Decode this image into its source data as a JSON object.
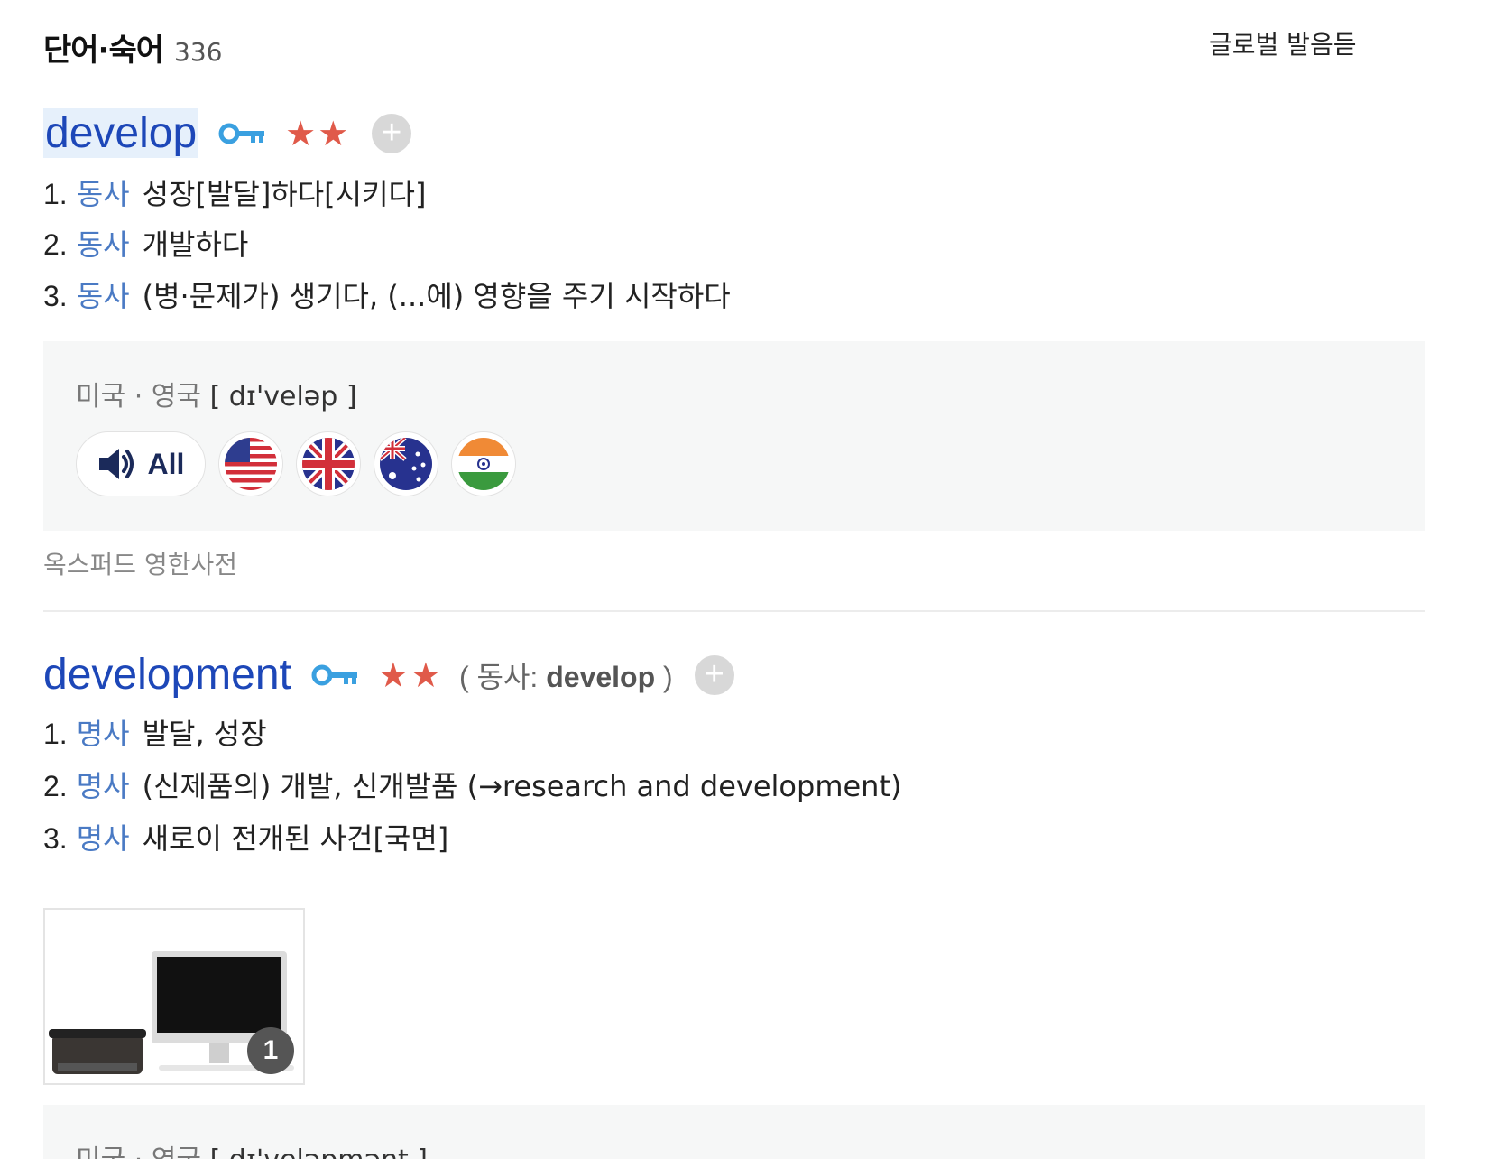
{
  "section": {
    "title": "단어·숙어",
    "count": "336",
    "global_link": "글로벌 발음듣"
  },
  "entries": [
    {
      "headword": "develop",
      "stars": "★★",
      "meanings": [
        {
          "num": "1.",
          "pos": "동사",
          "text": "성장[발달]하다[시키다]"
        },
        {
          "num": "2.",
          "pos": "동사",
          "text": "개발하다"
        },
        {
          "num": "3.",
          "pos": "동사",
          "text": "(병·문제가) 생기다, (...에) 영향을 주기 시작하다"
        }
      ],
      "pronunciation": {
        "lang": "미국 · 영국",
        "ipa": "[ dɪ'veləp ]"
      },
      "audio": {
        "all_label": "All"
      },
      "source": "옥스퍼드 영한사전"
    },
    {
      "headword": "development",
      "stars": "★★",
      "relation": {
        "prefix": "( 동사: ",
        "word": "develop",
        "suffix": " )"
      },
      "meanings": [
        {
          "num": "1.",
          "pos": "명사",
          "text": "발달, 성장"
        },
        {
          "num": "2.",
          "pos": "명사",
          "text": "(신제품의) 개발, 신개발품 (→research and development)"
        },
        {
          "num": "3.",
          "pos": "명사",
          "text": "새로이 전개된 사건[국면]"
        }
      ],
      "image_count": "1",
      "pronunciation": {
        "lang": "미국 · 영국",
        "ipa": "[ dɪ'veləpmənt ]"
      }
    }
  ],
  "icons": {
    "key": "key-icon",
    "plus": "plus-icon",
    "speaker": "speaker-icon",
    "flags": [
      "us-flag-icon",
      "uk-flag-icon",
      "australia-flag-icon",
      "india-flag-icon"
    ]
  },
  "colors": {
    "headword": "#1d47b8",
    "pos": "#4a7ac4",
    "stars": "#e05a4a",
    "box": "#f6f7f7"
  }
}
